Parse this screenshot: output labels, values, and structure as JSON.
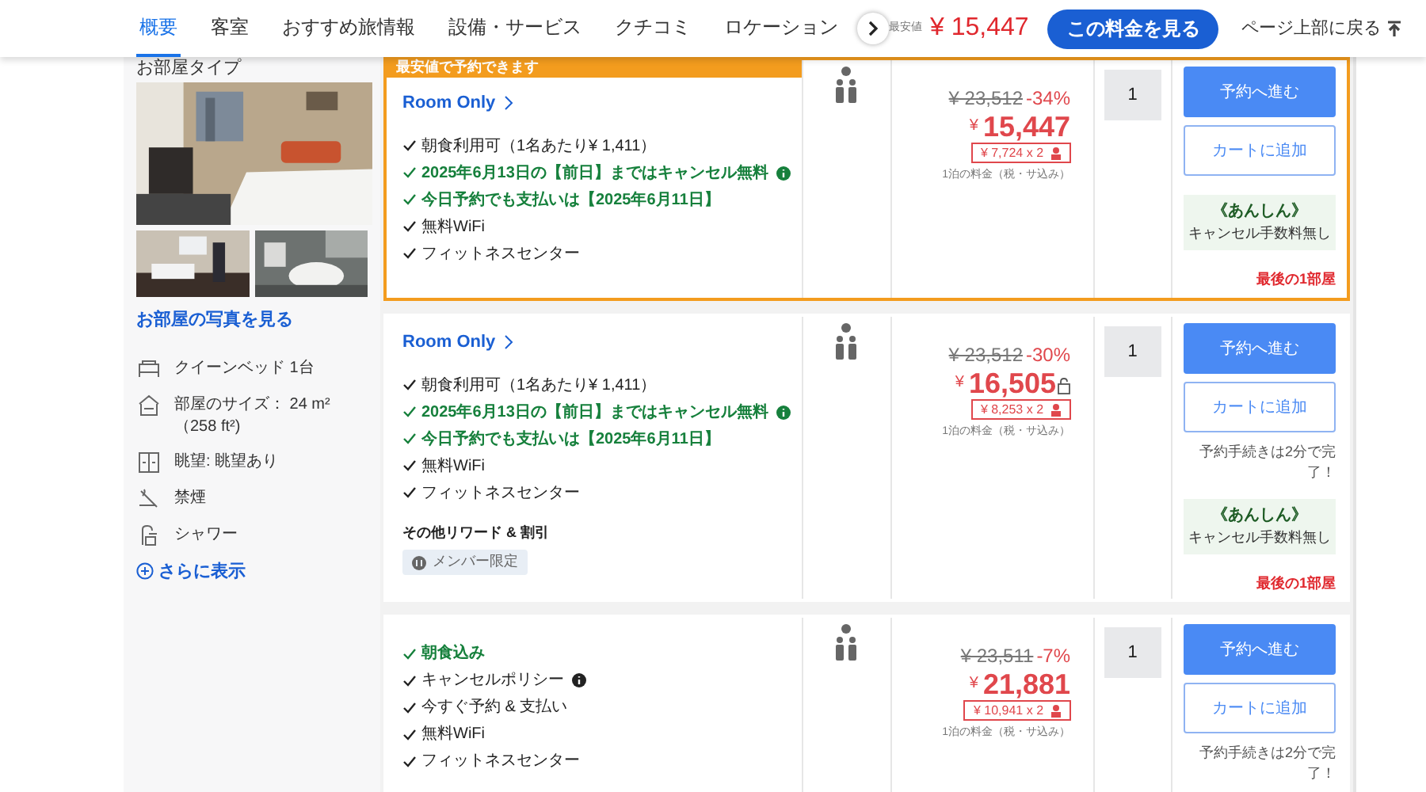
{
  "nav": {
    "tabs": [
      {
        "label": "概要",
        "selected": true
      },
      {
        "label": "客室",
        "selected": false
      },
      {
        "label": "おすすめ旅情報",
        "selected": false
      },
      {
        "label": "設備・サービス",
        "selected": false
      },
      {
        "label": "クチコミ",
        "selected": false
      },
      {
        "label": "ロケーション",
        "selected": false
      }
    ],
    "lowest_label": "最安値",
    "lowest_price": "¥ 15,447",
    "see_rate_button": "この料金を見る",
    "back_to_top": "ページ上部に戻る"
  },
  "room_panel": {
    "title": "お部屋タイプ",
    "photos_link": "お部屋の写真を見る",
    "amenities": [
      {
        "kind": "bed",
        "text": "クイーンベッド 1台"
      },
      {
        "kind": "size",
        "text": "部屋のサイズ： 24 m² （258 ft²)"
      },
      {
        "kind": "view",
        "text": "眺望: 眺望あり"
      },
      {
        "kind": "nosmoking",
        "text": "禁煙"
      },
      {
        "kind": "shower",
        "text": "シャワー"
      }
    ],
    "more_link": "さらに表示"
  },
  "offers": [
    {
      "highlighted": true,
      "banner": "最安値で予約できます",
      "title": "Room Only",
      "features": [
        {
          "text": "朝食利用可（1名あたり¥ 1,411）",
          "green": false,
          "info": false
        },
        {
          "text": "2025年6月13日の【前日】まではキャンセル無料",
          "green": true,
          "info": true
        },
        {
          "text": "今日予約でも支払いは【2025年6月11日】",
          "green": true,
          "info": false
        },
        {
          "text": "無料WiFi",
          "green": false,
          "info": false
        },
        {
          "text": "フィットネスセンター",
          "green": false,
          "info": false
        }
      ],
      "original_price": "¥ 23,512",
      "discount": "-34%",
      "price_yen": "¥",
      "price": "15,447",
      "locked": false,
      "per_person": "¥ 7,724 x 2",
      "price_note": "1泊の料金（税・サ込み）",
      "quantity": "1",
      "book_button": "予約へ進む",
      "cart_button": "カートに追加",
      "anshin_title": "《あんしん》",
      "anshin_text": "キャンセル手数料無し",
      "last_room": "最後の1部屋"
    },
    {
      "highlighted": false,
      "title": "Room Only",
      "features": [
        {
          "text": "朝食利用可（1名あたり¥ 1,411）",
          "green": false,
          "info": false
        },
        {
          "text": "2025年6月13日の【前日】まではキャンセル無料",
          "green": true,
          "info": true
        },
        {
          "text": "今日予約でも支払いは【2025年6月11日】",
          "green": true,
          "info": false
        },
        {
          "text": "無料WiFi",
          "green": false,
          "info": false
        },
        {
          "text": "フィットネスセンター",
          "green": false,
          "info": false
        }
      ],
      "rewards_title": "その他リワード & 割引",
      "rewards_tag": "メンバー限定",
      "original_price": "¥ 23,512",
      "discount": "-30%",
      "price_yen": "¥",
      "price": "16,505",
      "locked": true,
      "per_person": "¥ 8,253 x 2",
      "price_note": "1泊の料金（税・サ込み）",
      "quantity": "1",
      "book_button": "予約へ進む",
      "cart_button": "カートに追加",
      "quick_note": "予約手続きは2分で完了！",
      "anshin_title": "《あんしん》",
      "anshin_text": "キャンセル手数料無し",
      "last_room": "最後の1部屋"
    },
    {
      "highlighted": false,
      "features": [
        {
          "text": "朝食込み",
          "green": true,
          "info": false
        },
        {
          "text": "キャンセルポリシー",
          "green": false,
          "info": true
        },
        {
          "text": "今すぐ予約 & 支払い",
          "green": false,
          "info": false
        },
        {
          "text": "無料WiFi",
          "green": false,
          "info": false
        },
        {
          "text": "フィットネスセンター",
          "green": false,
          "info": false
        }
      ],
      "original_price": "¥ 23,511",
      "discount": "-7%",
      "price_yen": "¥",
      "price": "21,881",
      "locked": false,
      "per_person": "¥ 10,941 x 2",
      "price_note": "1泊の料金（税・サ込み）",
      "quantity": "1",
      "book_button": "予約へ進む",
      "cart_button": "カートに追加",
      "quick_note": "予約手続きは2分で完了！"
    }
  ]
}
